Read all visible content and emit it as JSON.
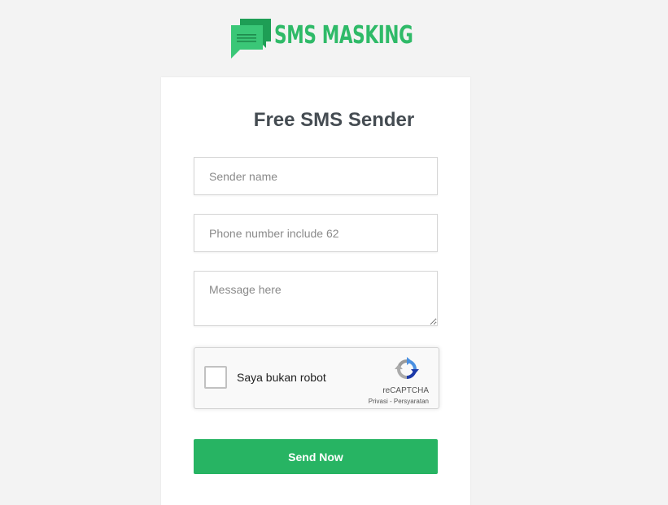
{
  "logo": {
    "text": "SMS MASKING",
    "icon": "chat-bubbles-icon",
    "color": "#2fba68"
  },
  "form": {
    "title": "Free SMS Sender",
    "sender_placeholder": "Sender name",
    "phone_placeholder": "Phone number include 62",
    "message_placeholder": "Message here",
    "submit_label": "Send Now",
    "button_color": "#27b463"
  },
  "captcha": {
    "label": "Saya bukan robot",
    "brand": "reCAPTCHA",
    "privacy_link": "Privasi",
    "separator": " - ",
    "terms_link": "Persyaratan",
    "icon": "recaptcha-logo-icon"
  },
  "colors": {
    "background": "#f3f3f3",
    "card": "#ffffff",
    "title": "#454c52"
  }
}
